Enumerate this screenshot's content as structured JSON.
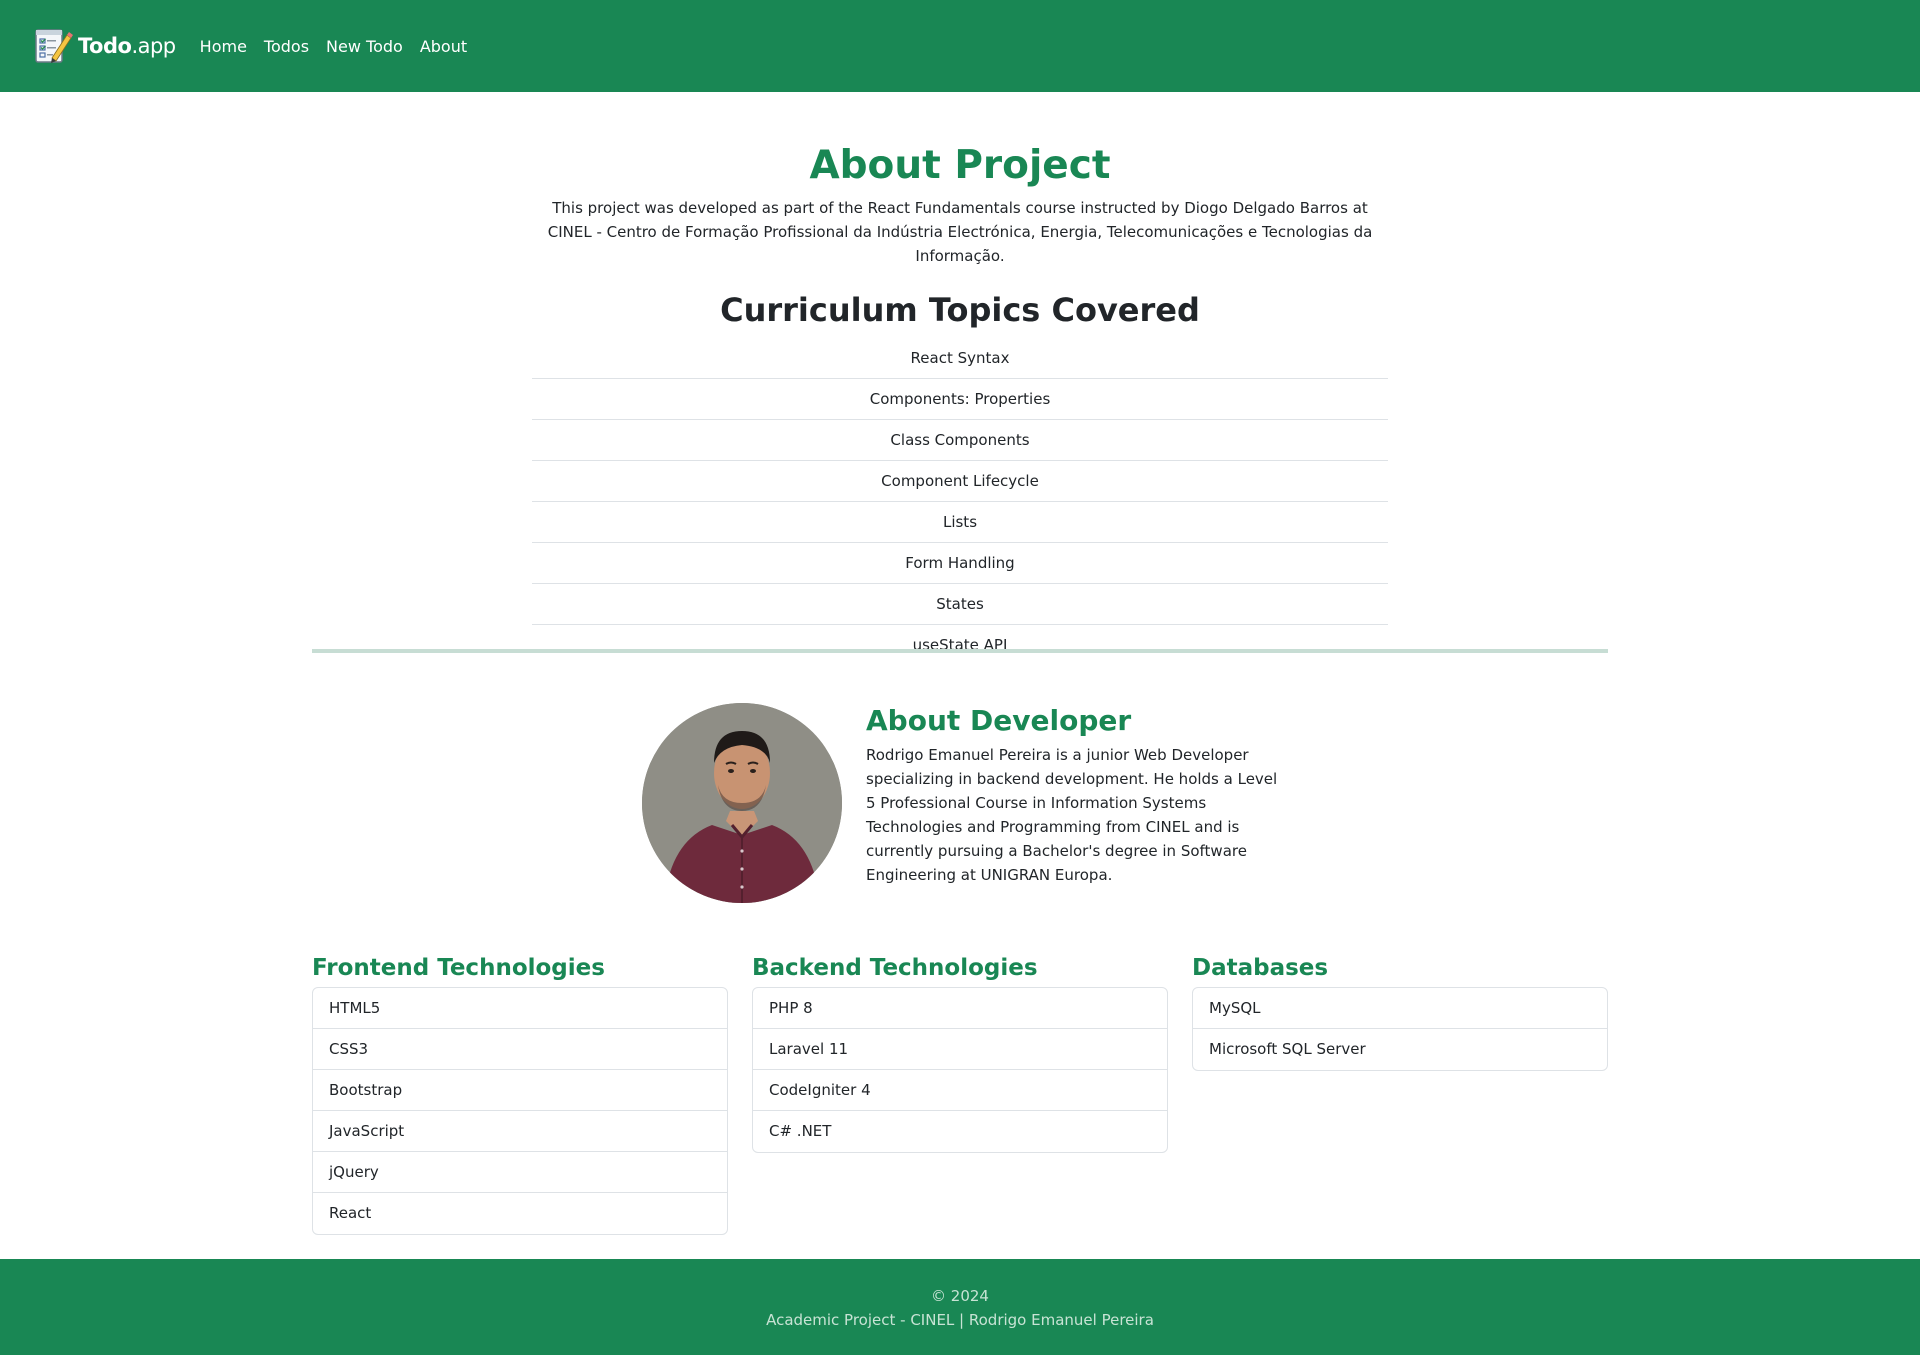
{
  "navbar": {
    "brand_bold": "Todo",
    "brand_light": ".app",
    "links": [
      "Home",
      "Todos",
      "New Todo",
      "About"
    ]
  },
  "project": {
    "title": "About Project",
    "description": "This project was developed as part of the React Fundamentals course instructed by Diogo Delgado Barros at CINEL - Centro de Formação Profissional da Indústria Electrónica, Energia, Telecomunicações e Tecnologias da Informação.",
    "topics_title": "Curriculum Topics Covered",
    "topics": [
      "React Syntax",
      "Components: Properties",
      "Class Components",
      "Component Lifecycle",
      "Lists",
      "Form Handling",
      "States",
      "useState API"
    ]
  },
  "developer": {
    "title": "About Developer",
    "bio": "Rodrigo Emanuel Pereira is a junior Web Developer specializing in backend development. He holds a Level 5 Professional Course in Information Systems Technologies and Programming from CINEL and is currently pursuing a Bachelor's degree in Software Engineering at UNIGRAN Europa."
  },
  "tech": {
    "frontend": {
      "title": "Frontend Technologies",
      "items": [
        "HTML5",
        "CSS3",
        "Bootstrap",
        "JavaScript",
        "jQuery",
        "React"
      ]
    },
    "backend": {
      "title": "Backend Technologies",
      "items": [
        "PHP 8",
        "Laravel 11",
        "CodeIgniter 4",
        "C# .NET"
      ]
    },
    "databases": {
      "title": "Databases",
      "items": [
        "MySQL",
        "Microsoft SQL Server"
      ]
    }
  },
  "footer": {
    "copyright": "© 2024",
    "credit": "Academic Project - CINEL | Rodrigo Emanuel Pereira"
  },
  "colors": {
    "brand_green": "#198754",
    "divider": "#c7ddd4"
  },
  "icons": {
    "brand": "todo-notepad-pencil-icon",
    "avatar": "developer-photo"
  }
}
